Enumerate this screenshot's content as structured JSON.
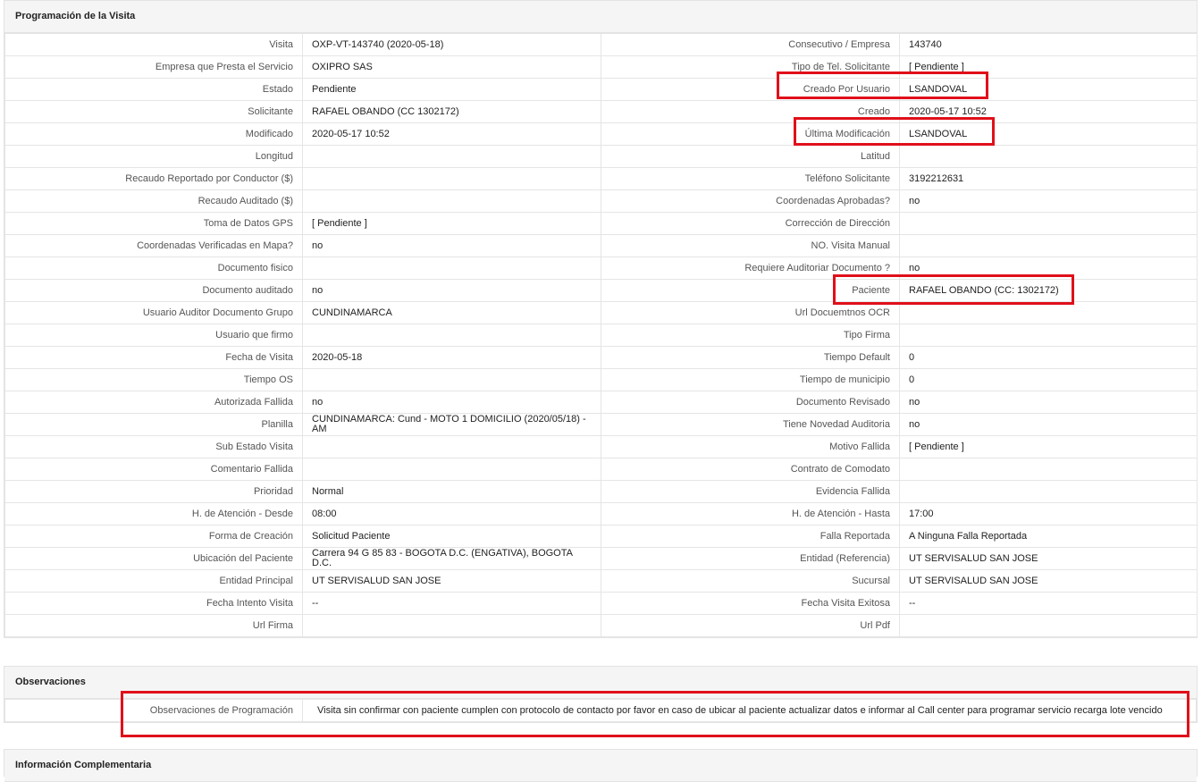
{
  "section1": {
    "title": "Programación de la Visita",
    "rows": [
      [
        "Visita",
        "OXP-VT-143740 (2020-05-18)",
        "Consecutivo / Empresa",
        "143740"
      ],
      [
        "Empresa que Presta el Servicio",
        "OXIPRO SAS",
        "Tipo de Tel. Solicitante",
        "[ Pendiente ]"
      ],
      [
        "Estado",
        "Pendiente",
        "Creado Por Usuario",
        "LSANDOVAL"
      ],
      [
        "Solicitante",
        "RAFAEL OBANDO (CC 1302172)",
        "Creado",
        "2020-05-17 10:52"
      ],
      [
        "Modificado",
        "2020-05-17 10:52",
        "Última Modificación",
        "LSANDOVAL"
      ],
      [
        "Longitud",
        "",
        "Latitud",
        ""
      ],
      [
        "Recaudo Reportado por Conductor ($)",
        "",
        "Teléfono Solicitante",
        "3192212631"
      ],
      [
        "Recaudo Auditado ($)",
        "",
        "Coordenadas Aprobadas?",
        "no"
      ],
      [
        "Toma de Datos GPS",
        "[ Pendiente ]",
        "Corrección de Dirección",
        ""
      ],
      [
        "Coordenadas Verificadas en Mapa?",
        "no",
        "NO. Visita Manual",
        ""
      ],
      [
        "Documento fisico",
        "",
        "Requiere Auditoriar Documento ?",
        "no"
      ],
      [
        "Documento auditado",
        "no",
        "Paciente",
        "RAFAEL OBANDO (CC: 1302172)"
      ],
      [
        "Usuario Auditor Documento Grupo",
        "CUNDINAMARCA",
        "Url Docuemtnos OCR",
        ""
      ],
      [
        "Usuario que firmo",
        "",
        "Tipo Firma",
        ""
      ],
      [
        "Fecha de Visita",
        "2020-05-18",
        "Tiempo Default",
        "0"
      ],
      [
        "Tiempo OS",
        "",
        "Tiempo de municipio",
        "0"
      ],
      [
        "Autorizada Fallida",
        "no",
        "Documento Revisado",
        "no"
      ],
      [
        "Planilla",
        "CUNDINAMARCA: Cund - MOTO 1 DOMICILIO (2020/05/18) - AM",
        "Tiene Novedad Auditoria",
        "no"
      ],
      [
        "Sub Estado Visita",
        "",
        "Motivo Fallida",
        "[ Pendiente ]"
      ],
      [
        "Comentario Fallida",
        "",
        "Contrato de Comodato",
        ""
      ],
      [
        "Prioridad",
        "Normal",
        "Evidencia Fallida",
        ""
      ],
      [
        "H. de Atención - Desde",
        "08:00",
        "H. de Atención - Hasta",
        "17:00"
      ],
      [
        "Forma de Creación",
        "Solicitud Paciente",
        "Falla Reportada",
        "A Ninguna Falla Reportada"
      ],
      [
        "Ubicación del Paciente",
        "Carrera 94 G 85 83 - BOGOTA D.C. (ENGATIVA), BOGOTA D.C.",
        "Entidad (Referencia)",
        "UT SERVISALUD SAN JOSE"
      ],
      [
        "Entidad Principal",
        "UT SERVISALUD SAN JOSE",
        "Sucursal",
        "UT SERVISALUD SAN JOSE"
      ],
      [
        "Fecha Intento Visita",
        "--",
        "Fecha Visita Exitosa",
        "--"
      ],
      [
        "Url Firma",
        "",
        "Url Pdf",
        ""
      ]
    ]
  },
  "section2": {
    "title": "Observaciones",
    "label": "Observaciones de Programación",
    "value": "Visita sin confirmar con paciente cumplen con protocolo de contacto por favor en caso de ubicar al paciente actualizar datos e informar al Call center para programar servicio recarga lote vencido"
  },
  "section3": {
    "title": "Información Complementaria"
  },
  "highlight_color": "#e0101a"
}
